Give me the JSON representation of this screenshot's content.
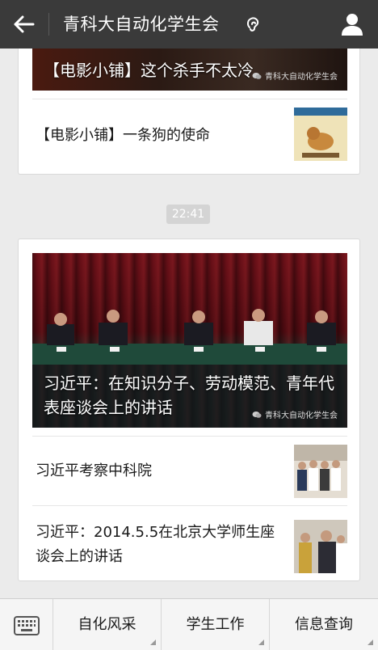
{
  "header": {
    "title": "青科大自动化学生会",
    "back_icon": "back-arrow-icon",
    "listen_icon": "ear-icon",
    "profile_icon": "person-icon"
  },
  "messages": [
    {
      "cover_title": "【电影小铺】这个杀手不太冷",
      "watermark": "青科大自动化学生会",
      "items": [
        {
          "title": "【电影小铺】一条狗的使命"
        }
      ]
    },
    {
      "time": "22:41",
      "cover_title": "习近平：在知识分子、劳动模范、青年代表座谈会上的讲话",
      "watermark": "青科大自动化学生会",
      "items": [
        {
          "title": "习近平考察中科院"
        },
        {
          "title": "习近平：2014.5.5在北京大学师生座谈会上的讲话"
        }
      ]
    }
  ],
  "menu": {
    "keyboard_icon": "keyboard-icon",
    "items": [
      {
        "label": "自化风采"
      },
      {
        "label": "学生工作"
      },
      {
        "label": "信息查询"
      }
    ]
  },
  "colors": {
    "header_bg": "#3a3a3a",
    "page_bg": "#ebebeb",
    "menu_bg": "#f5f5f5"
  }
}
